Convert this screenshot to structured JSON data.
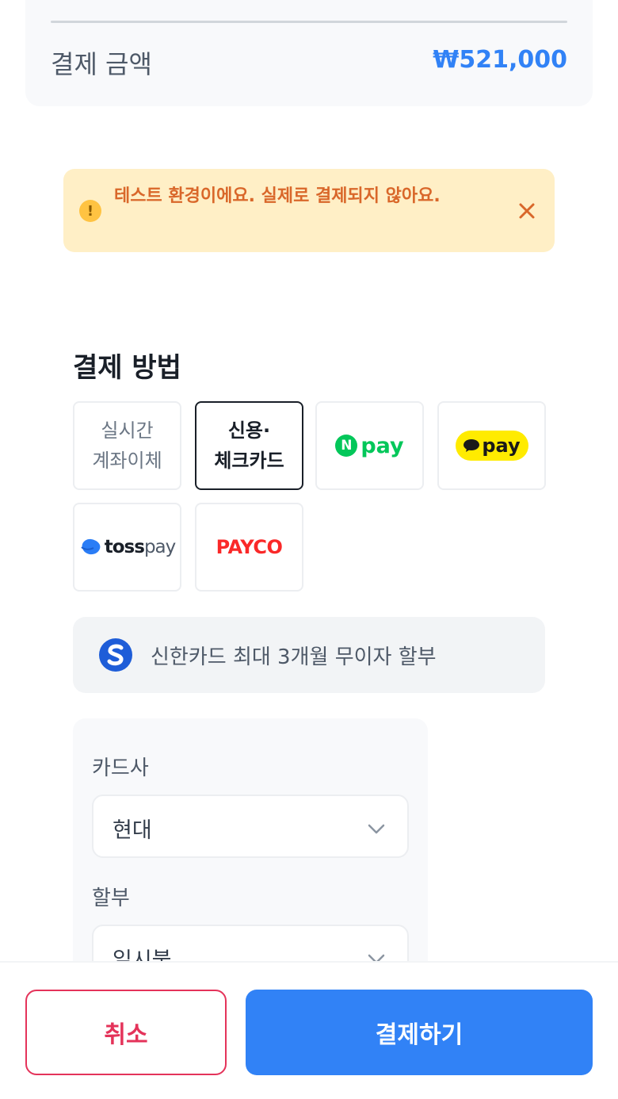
{
  "summary": {
    "label": "결제 금액",
    "amount": "₩521,000"
  },
  "test_banner": {
    "message": "테스트 환경이에요. 실제로 결제되지 않아요.",
    "icon": "warning-icon",
    "close_icon": "close-icon"
  },
  "payment_methods": {
    "title": "결제 방법",
    "items": [
      {
        "label_line1": "실시간",
        "label_line2": "계좌이체",
        "selected": false
      },
      {
        "label_line1": "신용·",
        "label_line2": "체크카드",
        "selected": true
      },
      {
        "brand": "N",
        "label": "pay",
        "selected": false
      },
      {
        "label": "pay",
        "selected": false
      },
      {
        "brand": "toss",
        "label": "pay",
        "selected": false
      },
      {
        "label": "PAYCO",
        "selected": false
      }
    ]
  },
  "promo": {
    "text": "신한카드 최대 3개월 무이자 할부",
    "icon": "shinhan-card-logo"
  },
  "card_form": {
    "card_company_label": "카드사",
    "card_company_value": "현대",
    "installment_label": "할부",
    "installment_value": "일시불"
  },
  "actions": {
    "cancel_label": "취소",
    "pay_label": "결제하기"
  },
  "colors": {
    "primary": "#3182f6",
    "danger": "#e4335a",
    "warning_bg": "#ffefc6",
    "warning_text": "#d9672a",
    "naver_green": "#03c75a",
    "kakao_yellow": "#ffeb00",
    "payco_red": "#fa2828"
  }
}
